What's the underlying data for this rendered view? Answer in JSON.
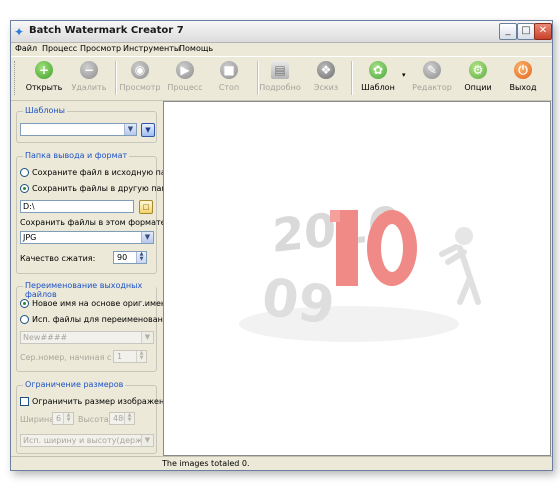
{
  "window": {
    "title": "Batch Watermark Creator 7"
  },
  "menu": [
    "Файл",
    "Процесс",
    "Просмотр",
    "Инструменты",
    "Помощь"
  ],
  "toolbar": {
    "open": "Открыть",
    "delete": "Удалить",
    "view": "Просмотр",
    "process": "Процесс",
    "stop": "Стоп",
    "details": "Подробно",
    "sketch": "Эскиз",
    "template": "Шаблон",
    "editor": "Редактор",
    "options": "Опции",
    "exit": "Выход"
  },
  "templates": {
    "title": "Шаблоны",
    "selected": ""
  },
  "output": {
    "title": "Папка вывода и формат",
    "radio_source": "Сохраните файл в исходную папку",
    "radio_other": "Сохранить файлы в другую папку",
    "path": "D:\\",
    "format_label": "Сохранить файлы в этом формате:",
    "format": "JPG",
    "quality_label": "Качество сжатия:",
    "quality": "90"
  },
  "rename": {
    "title": "Переименование выходных файлов",
    "radio_new": "Новое имя на основе ориг.имени",
    "radio_use": "Исп. файлы для переименования",
    "pattern": "New####",
    "serial_label": "Сер.номер, начиная с",
    "serial": "1"
  },
  "resize": {
    "title": "Ограничение размеров",
    "limit_label": "Ограничить размер изображения",
    "width_label": "Ширина:",
    "width": "6",
    "height_label": "Высота:",
    "height": "480",
    "mode": "Исп. ширину и высоту(держать"
  },
  "preview": {
    "text_2010": "2010",
    "text_09": "09"
  },
  "status": {
    "text": "The images totaled 0."
  },
  "colors": {
    "accent_red": "#d9534f",
    "green": "#5cb85c",
    "orange": "#f0712a",
    "group_title": "#1d52c7"
  }
}
